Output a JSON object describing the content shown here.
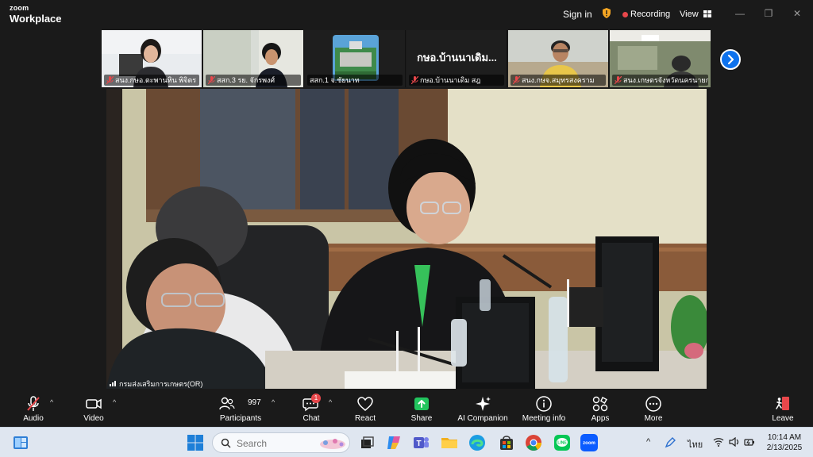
{
  "titlebar": {
    "brand_top": "zoom",
    "brand_bottom": "Workplace",
    "sign_in": "Sign in",
    "recording": "Recording",
    "view": "View",
    "minimize": "—",
    "restore": "❐",
    "close": "✕"
  },
  "gallery": {
    "tiles": [
      {
        "name": "สนง.กษอ.ตะพานหิน พิจิตร"
      },
      {
        "name": "สสก.3 รย. จักรพงศ์"
      },
      {
        "name": "สสก.1 จ.ชัยนาท"
      },
      {
        "name": "กษอ.บ้านนาเดิม สฎ",
        "big_text": "กษอ.บ้านนาเดิม..."
      },
      {
        "name": "สนง.กษจ.สมุทรสงคราม"
      },
      {
        "name": "สนง.เกษตรจังหวัดนครนายก"
      }
    ]
  },
  "main_video": {
    "speaker": "กรมส่งเสริมการเกษตร(OR)"
  },
  "toolbar": {
    "audio": "Audio",
    "video": "Video",
    "participants_count": "997",
    "participants": "Participants",
    "chat_badge": "1",
    "chat": "Chat",
    "react": "React",
    "share": "Share",
    "ai_companion": "AI Companion",
    "meeting_info": "Meeting info",
    "apps": "Apps",
    "more": "More",
    "leave": "Leave"
  },
  "taskbar": {
    "search_placeholder": "Search",
    "language": "ไทย",
    "time": "10:14 AM",
    "date": "2/13/2025"
  },
  "colors": {
    "accent_blue": "#0e72ed",
    "recording_red": "#e8474b",
    "share_green": "#22c55e",
    "leave_red": "#e8474b"
  }
}
